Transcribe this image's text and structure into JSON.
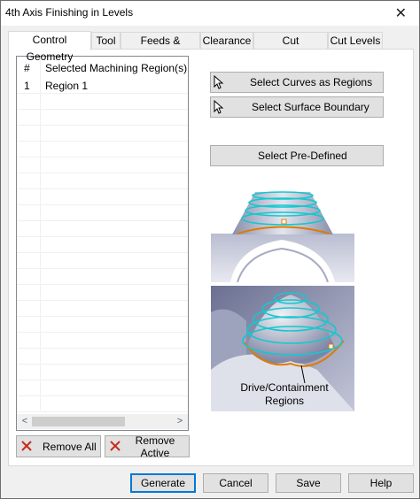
{
  "window": {
    "title": "4th Axis Finishing in Levels",
    "close_glyph": "✕"
  },
  "tabs": [
    {
      "label": "Control Geometry",
      "active": true
    },
    {
      "label": "Tool",
      "active": false
    },
    {
      "label": "Feeds & Speeds",
      "active": false
    },
    {
      "label": "Clearance",
      "active": false
    },
    {
      "label": "Cut Parameters",
      "active": false
    },
    {
      "label": "Cut Levels",
      "active": false
    }
  ],
  "region_list": {
    "col_hash": "#",
    "col_name": "Selected Machining Region(s)",
    "rows": [
      {
        "num": "1",
        "name": "Region 1"
      }
    ]
  },
  "scrollbar": {
    "left_glyph": "<",
    "right_glyph": ">"
  },
  "list_buttons": {
    "remove_all": "Remove All",
    "remove_active": "Remove Active"
  },
  "select_buttons": {
    "curves": "Select Curves as Regions",
    "surface": "Select Surface Boundary",
    "predefined": "Select Pre-Defined"
  },
  "illustration": {
    "caption_line1": "Drive/Containment",
    "caption_line2": "Regions"
  },
  "footer": {
    "generate": "Generate",
    "cancel": "Cancel",
    "save": "Save",
    "help": "Help"
  },
  "colors": {
    "accent_border": "#0078d7",
    "toolpath": "#12c9d0",
    "boundary": "#e07b00",
    "x_icon": "#c42b1c"
  }
}
